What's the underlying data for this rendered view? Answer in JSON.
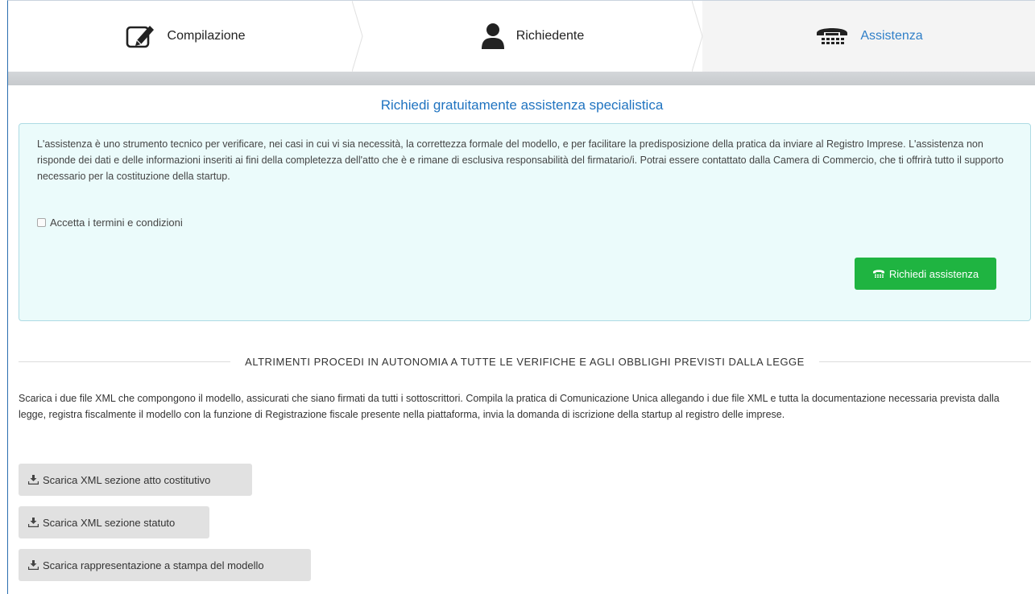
{
  "steps": [
    {
      "label": "Compilazione",
      "icon": "edit-icon"
    },
    {
      "label": "Richiedente",
      "icon": "user-icon"
    },
    {
      "label": "Assistenza",
      "icon": "phone-icon"
    }
  ],
  "heading": "Richiedi gratuitamente assistenza specialistica",
  "info": {
    "text": "L'assistenza è uno strumento tecnico per verificare, nei casi in cui vi sia necessità, la correttezza formale del modello, e per facilitare la predisposizione della pratica da inviare al Registro Imprese. L'assistenza non risponde dei dati e delle informazioni inseriti ai fini della completezza dell'atto che è e rimane di esclusiva responsabilità del firmatario/i. Potrai essere contattato dalla Camera di Commercio, che ti offrirà tutto il supporto necessario per la costituzione della startup.",
    "checkbox_label": "Accetta i termini e condizioni",
    "checkbox_checked": false,
    "button_label": "Richiedi assistenza"
  },
  "divider_text": "ALTRIMENTI PROCEDI IN AUTONOMIA A TUTTE LE VERIFICHE E AGLI OBBLIGHI PREVISTI DALLA LEGGE",
  "description": "Scarica i due file XML che compongono il modello, assicurati che siano firmati da tutti i sottoscrittori. Compila la pratica di Comunicazione Unica allegando i due file XML e tutta la documentazione necessaria prevista dalla legge, registra fiscalmente il modello con la funzione di Registrazione fiscale presente nella piattaforma, invia la domanda di iscrizione della startup al registro delle imprese.",
  "downloads": [
    {
      "label": "Scarica XML sezione atto costitutivo",
      "icon": "download-icon"
    },
    {
      "label": "Scarica XML sezione statuto",
      "icon": "download-icon"
    },
    {
      "label": "Scarica rappresentazione a stampa del modello",
      "icon": "download-icon"
    }
  ],
  "colors": {
    "accent": "#1f73c0",
    "success": "#1fb441",
    "info_bg": "#ebfbfb",
    "info_border": "#aedbe4"
  }
}
